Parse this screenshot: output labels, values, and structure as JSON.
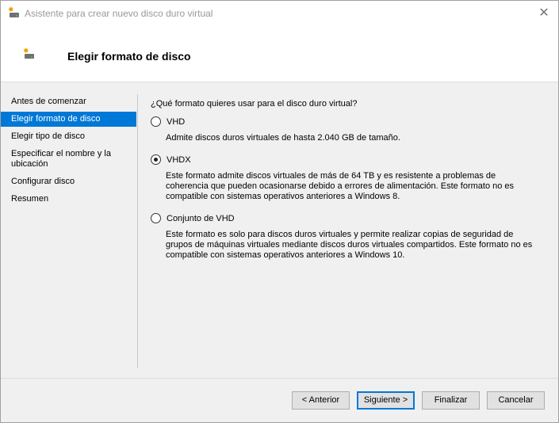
{
  "window": {
    "title": "Asistente para crear nuevo disco duro virtual",
    "close_icon": "close-icon"
  },
  "header": {
    "title": "Elegir formato de disco",
    "icon": "virtual-disk-icon"
  },
  "nav": {
    "items": [
      {
        "label": "Antes de comenzar",
        "selected": false
      },
      {
        "label": "Elegir formato de disco",
        "selected": true
      },
      {
        "label": "Elegir tipo de disco",
        "selected": false
      },
      {
        "label": "Especificar el nombre y la ubicación",
        "selected": false
      },
      {
        "label": "Configurar disco",
        "selected": false
      },
      {
        "label": "Resumen",
        "selected": false
      }
    ]
  },
  "main": {
    "question": "¿Qué formato quieres usar para el disco duro virtual?",
    "options": [
      {
        "label": "VHD",
        "checked": false,
        "description": "Admite discos duros virtuales de hasta 2.040 GB de tamaño."
      },
      {
        "label": "VHDX",
        "checked": true,
        "description": "Este formato admite discos virtuales de más de 64 TB y es resistente a problemas de coherencia que pueden ocasionarse debido a errores de alimentación. Este formato no es compatible con sistemas operativos anteriores a Windows 8."
      },
      {
        "label": "Conjunto de VHD",
        "checked": false,
        "description": "Este formato es solo para discos duros virtuales y permite realizar copias de seguridad de grupos de máquinas virtuales mediante discos duros virtuales compartidos. Este formato no es compatible con sistemas operativos anteriores a Windows 10."
      }
    ]
  },
  "buttons": {
    "previous": "< Anterior",
    "next": "Siguiente >",
    "finish": "Finalizar",
    "cancel": "Cancelar"
  },
  "colors": {
    "accent": "#0078d7"
  }
}
